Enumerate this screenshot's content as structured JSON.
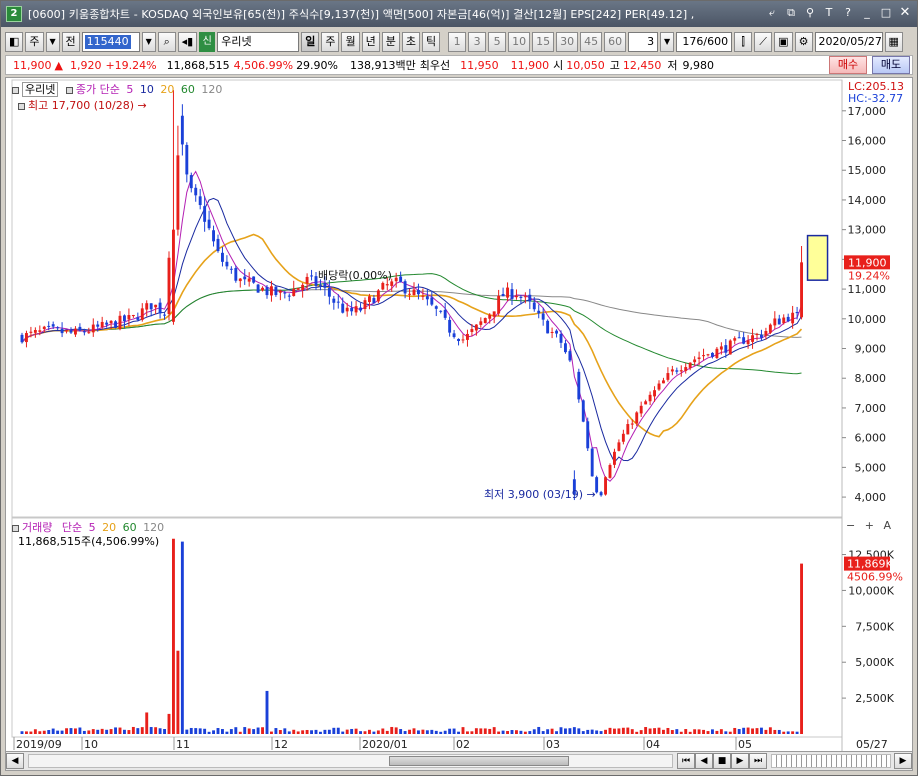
{
  "window": {
    "app_number": "2",
    "title": "[0600] 키움종합차트 - KOSDAQ 외국인보유[65(천)] 주식수[9,137(천)] 액면[500] 자본금[46(억)] 결산[12월] EPS[242] PER[49.12] ,"
  },
  "toolbar": {
    "period_week": "주",
    "prev_label": "전",
    "stock_code": "115440",
    "new_tag": "신",
    "stock_name": "우리넷",
    "period_tabs": [
      "일",
      "주",
      "월",
      "년",
      "분",
      "초",
      "틱"
    ],
    "interval_buttons": [
      "1",
      "3",
      "5",
      "10",
      "15",
      "30",
      "45",
      "60"
    ],
    "interval_select": "3",
    "count_display": "176/600",
    "date_value": "2020/05/27"
  },
  "quote": {
    "price": "11,900",
    "arrow": "▲",
    "change": "1,920",
    "change_pct": "+19.24%",
    "volume": "11,868,515",
    "volume_pct": "4,506.99%",
    "turnover": "29.90%",
    "amount": "138,913백만",
    "best_bid_label": "최우선",
    "best_ask": "11,950",
    "best_bid": "11,900",
    "open_label": "시",
    "open": "10,050",
    "high_label": "고",
    "high": "12,450",
    "low_label": "저",
    "low": "9,980",
    "buy_label": "매수",
    "sell_label": "매도"
  },
  "price_panel": {
    "stock_tag": "우리넷",
    "indicator_label": "종가 단순",
    "ma_periods": [
      "5",
      "10",
      "20",
      "60",
      "120"
    ],
    "max_label": "최고 17,700 (10/28)",
    "min_label": "최저 3,900 (03/19)",
    "dividend_label": "배당락(0.00%)",
    "lc_label": "LC:205.13",
    "hc_label": "HC:-32.77",
    "current_price_tag": "11,900",
    "current_pct_tag": "19.24%",
    "y_ticks": [
      "17,000",
      "16,000",
      "15,000",
      "14,000",
      "13,000",
      "12,000",
      "11,000",
      "10,000",
      "9,000",
      "8,000",
      "7,000",
      "6,000",
      "5,000",
      "4,000"
    ]
  },
  "volume_panel": {
    "label": "거래량",
    "indicator_label": "단순",
    "ma_periods": [
      "5",
      "20",
      "60",
      "120"
    ],
    "summary": "11,868,515주(4,506.99%)",
    "current_tag": "11,869K",
    "current_pct_tag": "4506.99%",
    "y_ticks": [
      "12,500K",
      "10,000K",
      "7,500K",
      "5,000K",
      "2,500K"
    ],
    "tools": [
      "−",
      "+",
      "A"
    ]
  },
  "x_axis": {
    "labels": [
      "2019/09",
      "10",
      "11",
      "12",
      "2020/01",
      "02",
      "03",
      "04",
      "05"
    ],
    "right_label": "05/27"
  },
  "colors": {
    "up": "#e8201b",
    "down": "#1a40d8",
    "ma5": "#b420b4",
    "ma10": "#1a2aa0",
    "ma20": "#e6a21a",
    "ma60": "#22882e",
    "ma120": "#888888"
  },
  "chart_data": [
    {
      "type": "candlestick",
      "title": "우리넷",
      "y_unit": "KRW",
      "ylim": [
        3700,
        17700
      ],
      "x_range": [
        "2019/09",
        "2020/05/27"
      ],
      "max": {
        "value": 17700,
        "date": "10/28"
      },
      "min": {
        "value": 3900,
        "date": "03/19"
      },
      "last": {
        "open": 10050,
        "high": 12450,
        "low": 9980,
        "close": 11900
      },
      "moving_averages": [
        "5",
        "10",
        "20",
        "60",
        "120"
      ]
    },
    {
      "type": "bar",
      "title": "거래량",
      "y_unit": "shares",
      "ylim": [
        0,
        14000000
      ],
      "last_value": 11868515
    }
  ]
}
